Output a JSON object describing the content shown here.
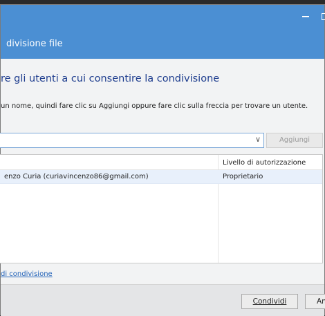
{
  "window": {
    "title": "divisione file"
  },
  "main": {
    "heading": "re gli utenti a cui consentire la condivisione",
    "instruction": "un nome, quindi fare clic su Aggiungi oppure fare clic sulla freccia per trovare un utente.",
    "combo_arrow": "∨",
    "add_label": "Aggiungi"
  },
  "table": {
    "header_permission": "Livello di autorizzazione",
    "rows": [
      {
        "user": "enzo Curia (curiavincenzo86@gmail.com)",
        "permission": "Proprietario"
      }
    ]
  },
  "footer": {
    "link": "di condivisione",
    "share_label": "Condividi",
    "cancel_label": "An"
  },
  "icons": {
    "minimize": "minimize-icon",
    "maximize": "maximize-icon",
    "combo": "chevron-down-icon"
  },
  "colors": {
    "titlebar": "#4b8fd3",
    "heading": "#1e3d8e",
    "link": "#2262b8"
  }
}
